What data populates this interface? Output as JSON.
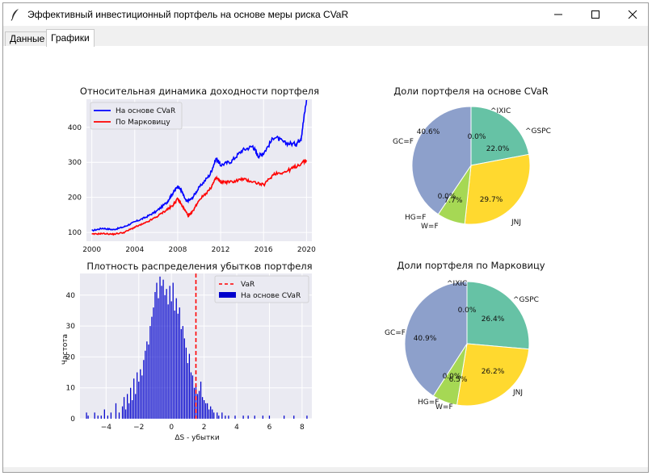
{
  "window": {
    "title": "Эффективный инвестиционный портфель на основе меры риска CVaR",
    "app_icon": "feather-icon",
    "controls": [
      "minimize-icon",
      "maximize-icon",
      "close-icon"
    ]
  },
  "tabs": [
    {
      "label": "Данные",
      "active": false
    },
    {
      "label": "Графики",
      "active": true
    }
  ],
  "colors": {
    "cvar_line": "#0000ff",
    "markowitz_line": "#ff0000",
    "var_line": "#ff0000",
    "hist_bar": "#0000cc",
    "axes_bg": "#eaeaf2",
    "pie_gspc": "#66c2a5",
    "pie_jnj": "#ffd92f",
    "pie_wf": "#a6d854",
    "pie_hgf": "#e78ac3",
    "pie_gcf": "#8da0cb",
    "pie_ixic": "#fc8d62"
  },
  "charts": {
    "returns": {
      "title": "Относительная динамика доходности портфеля",
      "legend": [
        "На основе CVaR",
        "По Марковицу"
      ],
      "legend_position": "upper-left",
      "xticks": [
        "2000",
        "2004",
        "2008",
        "2012",
        "2016",
        "2020"
      ],
      "yticks": [
        "100",
        "200",
        "300",
        "400"
      ]
    },
    "hist": {
      "title": "Плотность распределения убытков портфеля",
      "xlabel": "ΔS - убытки",
      "ylabel": "Частота",
      "legend": [
        "VaR",
        "На основе CVaR"
      ],
      "legend_position": "upper-right",
      "xticks": [
        "−4",
        "−2",
        "0",
        "2",
        "4",
        "6",
        "8"
      ],
      "yticks": [
        "0",
        "10",
        "20",
        "30",
        "40"
      ]
    },
    "pie_cvar": {
      "title": "Доли портфеля на основе CVaR",
      "labels": {
        "gspc": "^GSPC",
        "jnj": "JNJ",
        "wf": "W=F",
        "hgf": "HG=F",
        "gcf": "GC=F",
        "ixic": "^IXIC"
      },
      "pct": {
        "gspc": "22.0%",
        "jnj": "29.7%",
        "wf": "7.7%",
        "hgf": "0.0%",
        "gcf": "40.6%",
        "ixic": "0.0%"
      }
    },
    "pie_mark": {
      "title": "Доли портфеля по Марковицу",
      "labels": {
        "gspc": "^GSPC",
        "jnj": "JNJ",
        "wf": "W=F",
        "hgf": "HG=F",
        "gcf": "GC=F",
        "ixic": "^IXIC"
      },
      "pct": {
        "gspc": "26.4%",
        "jnj": "26.2%",
        "wf": "6.5%",
        "hgf": "0.0%",
        "gcf": "40.9%",
        "ixic": "0.0%"
      }
    }
  },
  "chart_data": [
    {
      "type": "line",
      "title": "Относительная динамика доходности портфеля",
      "xlabel": "",
      "ylabel": "",
      "xlim": [
        1999.5,
        2020.5
      ],
      "ylim": [
        75,
        480
      ],
      "legend": "upper-left",
      "grid": true,
      "series": [
        {
          "name": "На основе CVaR",
          "color": "#0000ff",
          "x": [
            2000,
            2001,
            2002,
            2003,
            2004,
            2005,
            2006,
            2007,
            2007.5,
            2008,
            2008.3,
            2008.8,
            2009.3,
            2010,
            2011,
            2011.6,
            2012,
            2013,
            2014,
            2015,
            2015.5,
            2016,
            2017,
            2018,
            2019,
            2019.5,
            2020
          ],
          "y": [
            105,
            112,
            108,
            116,
            130,
            143,
            160,
            186,
            210,
            232,
            222,
            188,
            196,
            228,
            265,
            312,
            292,
            303,
            334,
            346,
            318,
            326,
            374,
            355,
            352,
            370,
            478
          ]
        },
        {
          "name": "По Марковицу",
          "color": "#ff0000",
          "x": [
            2000,
            2001,
            2002,
            2003,
            2004,
            2005,
            2006,
            2007,
            2007.5,
            2008,
            2008.5,
            2009,
            2009.3,
            2010,
            2011,
            2011.6,
            2012,
            2013,
            2014,
            2015,
            2016,
            2017,
            2018,
            2019,
            2020
          ],
          "y": [
            95,
            97,
            95,
            100,
            115,
            127,
            144,
            165,
            176,
            196,
            172,
            148,
            155,
            193,
            223,
            256,
            244,
            244,
            252,
            245,
            235,
            268,
            272,
            288,
            306
          ]
        }
      ]
    },
    {
      "type": "bar",
      "title": "Плотность распределения убытков портфеля",
      "xlabel": "ΔS - убытки",
      "ylabel": "Частота",
      "xlim": [
        -5.6,
        8.6
      ],
      "ylim": [
        0,
        47
      ],
      "legend": "upper-right",
      "grid": true,
      "var": 1.5,
      "series": [
        {
          "name": "На основе CVaR",
          "color": "#0000cc",
          "x": [
            -5.2,
            -5.1,
            -4.7,
            -4.5,
            -4.3,
            -4.1,
            -3.9,
            -3.7,
            -3.4,
            -3.2,
            -3.0,
            -2.9,
            -2.8,
            -2.7,
            -2.6,
            -2.5,
            -2.4,
            -2.3,
            -2.2,
            -2.1,
            -2.0,
            -1.9,
            -1.8,
            -1.7,
            -1.6,
            -1.5,
            -1.4,
            -1.3,
            -1.2,
            -1.1,
            -1.0,
            -0.9,
            -0.8,
            -0.7,
            -0.6,
            -0.5,
            -0.4,
            -0.3,
            -0.2,
            -0.1,
            0.0,
            0.1,
            0.2,
            0.3,
            0.4,
            0.5,
            0.6,
            0.7,
            0.8,
            0.9,
            1.0,
            1.1,
            1.2,
            1.3,
            1.4,
            1.5,
            1.6,
            1.7,
            1.8,
            1.9,
            2.0,
            2.1,
            2.2,
            2.3,
            2.4,
            2.5,
            2.6,
            2.8,
            2.9,
            3.1,
            3.3,
            3.5,
            3.9,
            4.4,
            4.7,
            5.1,
            5.6,
            6.0,
            6.9,
            7.5,
            8.3
          ],
          "y": [
            2,
            1,
            2,
            1,
            1,
            3,
            1,
            2,
            5,
            2,
            4,
            7,
            3,
            8,
            5,
            10,
            6,
            13,
            8,
            15,
            12,
            16,
            14,
            19,
            22,
            25,
            24,
            30,
            33,
            36,
            41,
            44,
            39,
            46,
            43,
            45,
            40,
            42,
            37,
            43,
            38,
            44,
            35,
            39,
            34,
            36,
            29,
            30,
            26,
            23,
            18,
            21,
            15,
            14,
            10,
            11,
            8,
            9,
            12,
            7,
            6,
            5,
            5,
            3,
            4,
            3,
            2,
            2,
            1,
            2,
            1,
            1,
            1,
            1,
            1,
            1,
            1,
            1,
            1,
            1,
            1
          ]
        }
      ]
    },
    {
      "type": "pie",
      "title": "Доли портфеля на основе CVaR",
      "categories": [
        "^GSPC",
        "JNJ",
        "W=F",
        "HG=F",
        "GC=F",
        "^IXIC"
      ],
      "values": [
        22.0,
        29.7,
        7.7,
        0.0,
        40.6,
        0.0
      ]
    },
    {
      "type": "pie",
      "title": "Доли портфеля по Марковицу",
      "categories": [
        "^GSPC",
        "JNJ",
        "W=F",
        "HG=F",
        "GC=F",
        "^IXIC"
      ],
      "values": [
        26.4,
        26.2,
        6.5,
        0.0,
        40.9,
        0.0
      ]
    }
  ]
}
